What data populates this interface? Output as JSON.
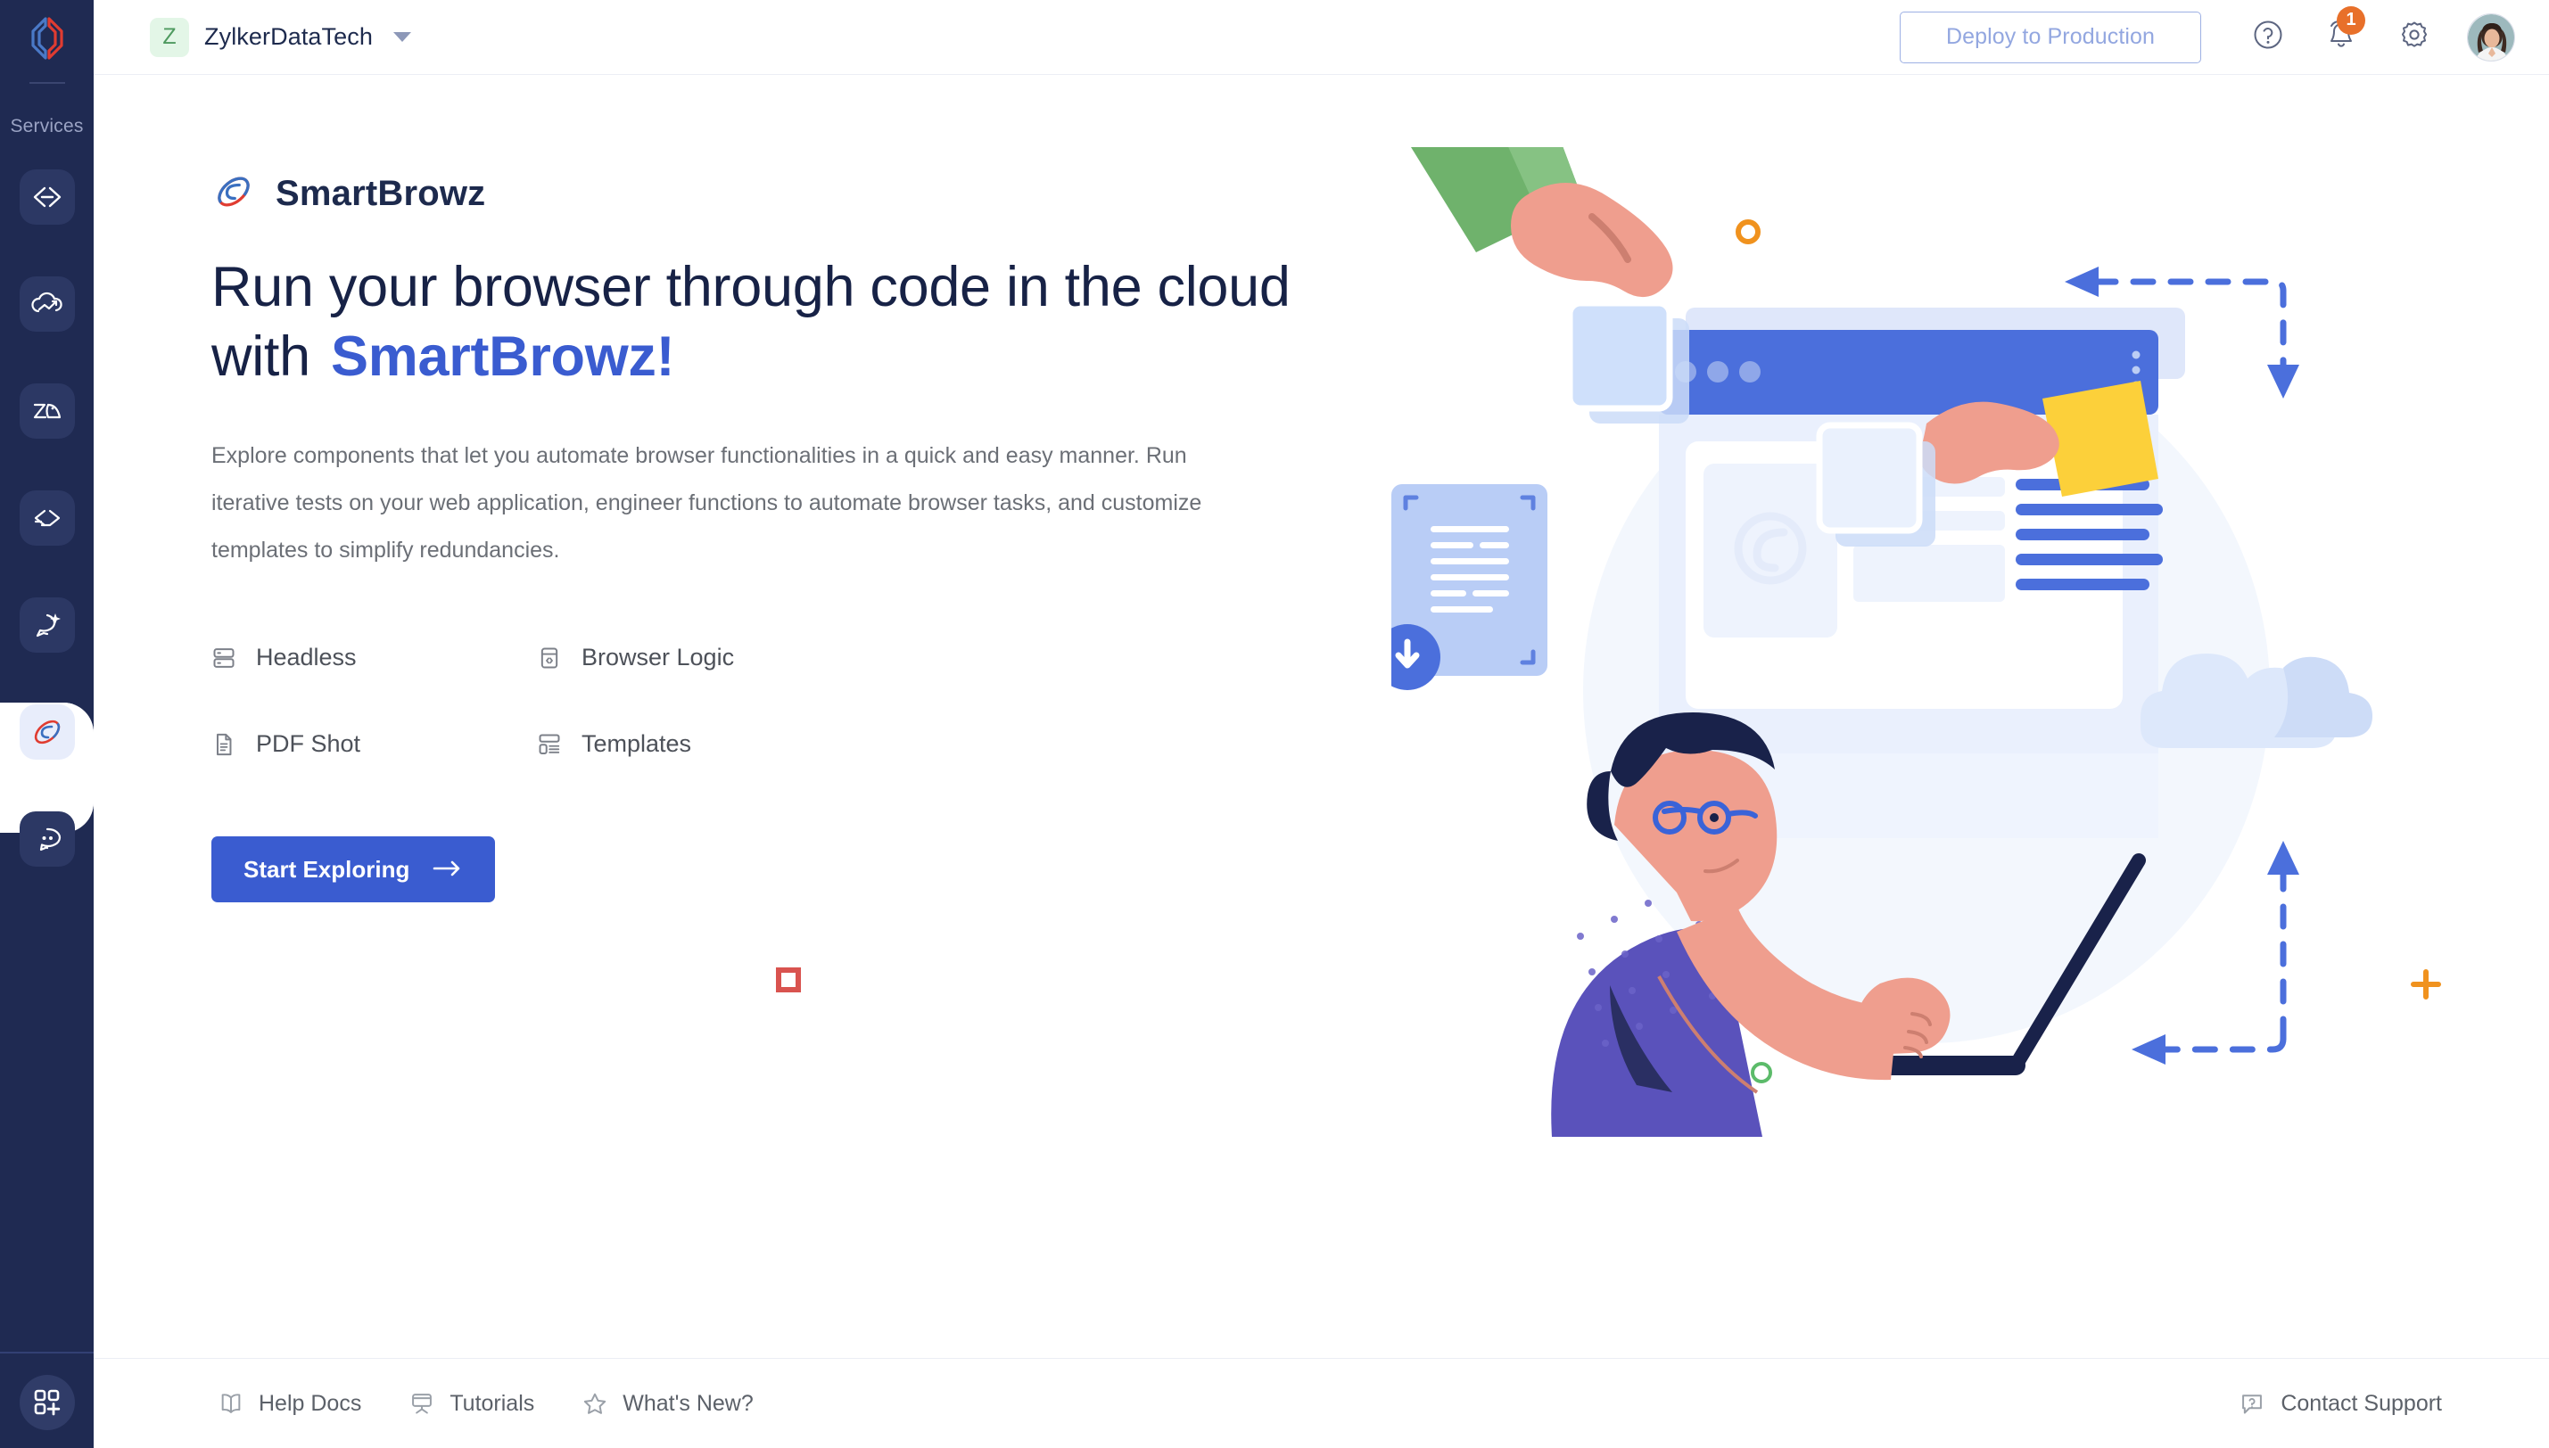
{
  "sidebar": {
    "logo_icon": "zoho-logo-icon",
    "section_label": "Services",
    "items": [
      {
        "name": "catalyst-code-icon",
        "icon": "code-brackets-icon"
      },
      {
        "name": "cloud-scale-icon",
        "icon": "cloud-arrow-icon"
      },
      {
        "name": "zia-icon",
        "icon": "zia-icon"
      },
      {
        "name": "quickml-icon",
        "icon": "double-chevron-icon"
      },
      {
        "name": "ai-chat-icon",
        "icon": "chat-sparkle-icon"
      },
      {
        "name": "smartbrowz-icon",
        "icon": "smartbrowz-orbit-icon",
        "active": true
      },
      {
        "name": "conversations-icon",
        "icon": "chat-bubble-eyes-icon"
      }
    ],
    "bottom_item": {
      "name": "add-app-icon",
      "icon": "grid-plus-icon"
    }
  },
  "header": {
    "org": {
      "initial": "Z",
      "name": "ZylkerDataTech",
      "caret_icon": "chevron-down-icon"
    },
    "deploy_label": "Deploy to Production",
    "help_icon": "question-circle-icon",
    "bell_icon": "bell-icon",
    "notification_count": "1",
    "gear_icon": "gear-icon",
    "avatar_name": "user-avatar"
  },
  "hero": {
    "logo_icon": "smartbrowz-orbit-icon",
    "product_name": "SmartBrowz",
    "headline_prefix": "Run your browser through code in the cloud with ",
    "headline_highlight": "SmartBrowz!",
    "description": "Explore components that let you automate browser functionalities in a quick and easy manner. Run iterative tests on your web application, engineer functions to automate browser tasks, and customize templates to simplify redundancies.",
    "features": [
      {
        "label": "Headless",
        "icon": "server-stack-icon"
      },
      {
        "label": "Browser Logic",
        "icon": "code-window-icon"
      },
      {
        "label": "PDF Shot",
        "icon": "document-lines-icon"
      },
      {
        "label": "Templates",
        "icon": "template-list-icon"
      }
    ],
    "cta_label": "Start Exploring",
    "cta_icon": "arrow-right-icon"
  },
  "footer": {
    "links": [
      {
        "label": "Help Docs",
        "icon": "book-icon"
      },
      {
        "label": "Tutorials",
        "icon": "presentation-icon"
      },
      {
        "label": "What's New?",
        "icon": "star-icon"
      }
    ],
    "support": {
      "label": "Contact Support",
      "icon": "chat-question-icon"
    }
  },
  "colors": {
    "rail_bg": "#1f2a52",
    "accent_blue": "#3a5cd0",
    "highlight_yellow": "#fbd65c",
    "badge_orange": "#e8702a",
    "deploy_border": "#9db0e4",
    "heading_navy": "#172246"
  }
}
